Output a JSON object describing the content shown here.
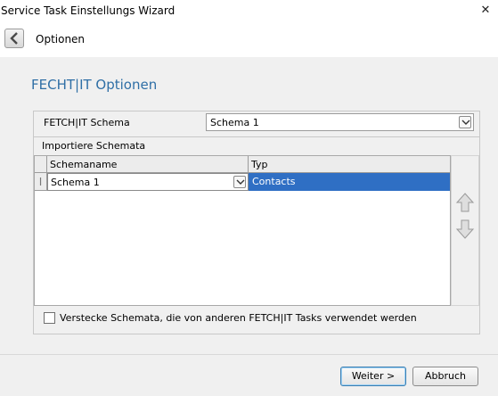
{
  "window": {
    "title": "Service Task Einstellungs Wizard",
    "close_glyph": "✕"
  },
  "nav": {
    "back_icon": "chevron-left-icon",
    "breadcrumb": "Optionen"
  },
  "main": {
    "heading": "FECHT|IT Optionen",
    "schema_label": "FETCH|IT Schema",
    "schema_value": "Schema 1",
    "import_group_label": "Importiere Schemata",
    "grid": {
      "columns": [
        "Schemaname",
        "Typ"
      ],
      "rows": [
        {
          "indicator": "I",
          "schemaname": "Schema 1",
          "typ": "Contacts"
        }
      ]
    },
    "hide_schemas_label": "Verstecke Schemata, die von anderen FETCH|IT Tasks verwendet werden",
    "hide_schemas_checked": false
  },
  "footer": {
    "next_label": "Weiter >",
    "cancel_label": "Abbruch"
  },
  "colors": {
    "heading": "#2f6fa6",
    "selection": "#2f6fc4"
  }
}
